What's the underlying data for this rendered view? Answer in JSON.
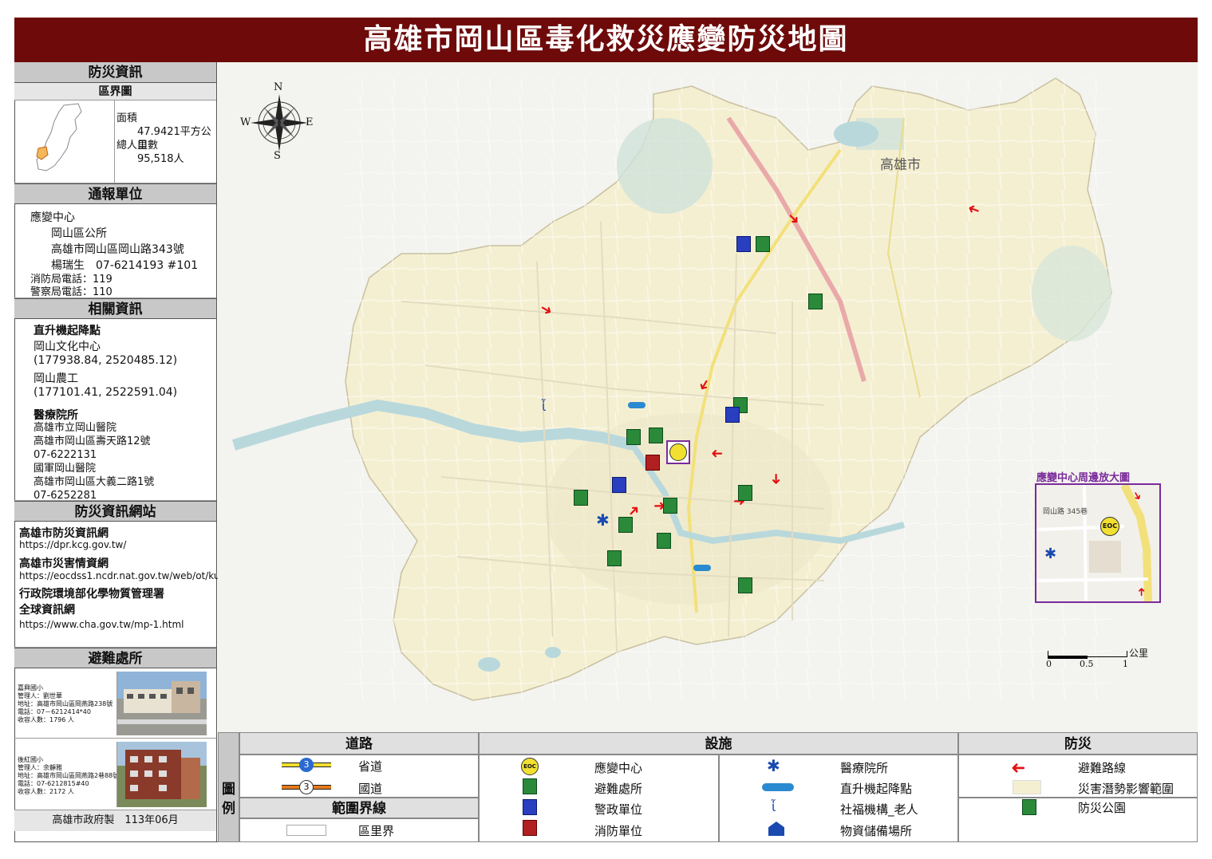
{
  "title": "高雄市岡山區毒化救災應變防災地圖",
  "side": {
    "info_title": "防災資訊",
    "boundary_title": "區界圖",
    "area_label": "面積",
    "area_value": "47.9421平方公里",
    "pop_label": "總人口數",
    "pop_value": "95,518人",
    "report_title": "通報單位",
    "eoc_label": "應變中心",
    "eoc_office": "岡山區公所",
    "eoc_address": "高雄市岡山區岡山路343號",
    "eoc_contact": "楊瑞生　07-6214193 #101",
    "fire_phone": "消防局電話：119",
    "police_phone": "警察局電話：110",
    "related_title": "相關資訊",
    "heli_title": "直升機起降點",
    "heli_1_name": "岡山文化中心",
    "heli_1_coord": "(177938.84, 2520485.12)",
    "heli_2_name": "岡山農工",
    "heli_2_coord": "(177101.41, 2522591.04)",
    "medical_title": "醫療院所",
    "hosp_1_name": "高雄市立岡山醫院",
    "hosp_1_addr": "高雄市岡山區壽天路12號",
    "hosp_1_phone": "07-6222131",
    "hosp_2_name": "國軍岡山醫院",
    "hosp_2_addr": "高雄市岡山區大義二路1號",
    "hosp_2_phone": "07-6252281",
    "web_title": "防災資訊網站",
    "web_1_name": "高雄市防災資訊網",
    "web_1_url": "https://dpr.kcg.gov.tw/",
    "web_2_name": "高雄市災害情資網",
    "web_2_url": "https://eocdss1.ncdr.nat.gov.tw/web/ot/ku",
    "web_3_name": "行政院環境部化學物質管理署",
    "web_3_name2": "全球資訊網",
    "web_3_url": "https://www.cha.gov.tw/mp-1.html",
    "shelter_title": "避難處所",
    "shelter_1_name": "嘉興國小",
    "shelter_1_mgr": "管理人：劉世華",
    "shelter_1_addr": "地址：高雄市岡山區岡燕路238號",
    "shelter_1_phone": "電話：07－6212414*40",
    "shelter_1_cap": "收容人數：1796 人",
    "shelter_2_name": "後紅國小",
    "shelter_2_mgr": "管理人：余靜雅",
    "shelter_2_addr": "地址：高雄市岡山區岡燕路2巷88號",
    "shelter_2_phone": "電話：07-6212815#40",
    "shelter_2_cap": "收容人數：2172 人",
    "footer": "高雄市政府製　113年06月"
  },
  "map": {
    "compass_n": "N",
    "compass_s": "S",
    "compass_e": "E",
    "compass_w": "W",
    "city_label": "高雄市",
    "inset_title": "應變中心周邊放大圖",
    "inset_eoc": "EOC",
    "inset_road": "岡山路 345巷",
    "scale_unit": "公里",
    "scale_0": "0",
    "scale_05": "0.5",
    "scale_1": "1"
  },
  "legend": {
    "side_label_1": "圖",
    "side_label_2": "例",
    "roads_title": "道路",
    "facilities_title": "設施",
    "disaster_title": "防災",
    "boundary_title": "範圍界線",
    "provincial_road": "省道",
    "provincial_num": "3",
    "national_road": "國道",
    "national_num": "3",
    "district_boundary": "區里界",
    "eoc": "應變中心",
    "eoc_icon_text": "EOC",
    "shelter": "避難處所",
    "police": "警政單位",
    "fire": "消防單位",
    "medical": "醫療院所",
    "heli": "直升機起降點",
    "welfare": "社福機構_老人",
    "storage": "物資儲備場所",
    "evac_route": "避難路線",
    "hazard_zone": "災害潛勢影響範圍",
    "disaster_park": "防災公園"
  },
  "colors": {
    "title_bg": "#6e0a0a",
    "district_fill": "#f5efd2",
    "river": "#b8d8dc",
    "arrow": "#e31010",
    "inset_border": "#7a2a9a"
  }
}
